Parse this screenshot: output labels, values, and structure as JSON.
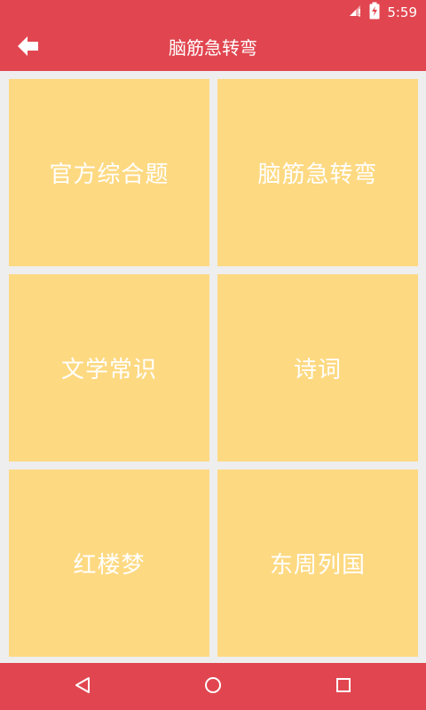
{
  "status_bar": {
    "time": "5:59",
    "icons": [
      "signal-icon",
      "battery-charging-icon"
    ]
  },
  "app_bar": {
    "title": "脑筋急转弯",
    "back_icon": "arrow-left-icon"
  },
  "categories": [
    {
      "label": "官方综合题"
    },
    {
      "label": "脑筋急转弯"
    },
    {
      "label": "文学常识"
    },
    {
      "label": "诗词"
    },
    {
      "label": "红楼梦"
    },
    {
      "label": "东周列国"
    }
  ],
  "nav_bar": {
    "icons": [
      "back-triangle-icon",
      "home-circle-icon",
      "recents-square-icon"
    ]
  },
  "colors": {
    "primary": "#e14650",
    "tile": "#fdd982",
    "background": "#eeeeee",
    "text": "#ffffff"
  }
}
